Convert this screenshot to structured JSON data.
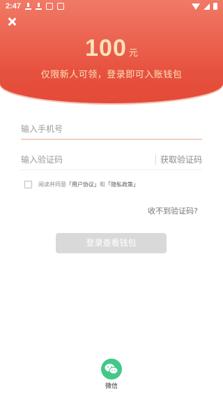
{
  "status_bar": {
    "time": "2:47"
  },
  "header": {
    "amount": "100",
    "unit": "元",
    "subtitle": "仅限新人可领，登录即可入账钱包"
  },
  "form": {
    "phone_placeholder": "输入手机号",
    "code_placeholder": "输入验证码",
    "get_code_label": "获取验证码",
    "agree_prefix": "阅读并同意",
    "user_agreement": "「用户协议」",
    "agree_and": "和",
    "privacy_policy": "「隐私政策」",
    "no_code_label": "收不到验证码?",
    "login_button": "登录查看钱包"
  },
  "social": {
    "wechat_label": "微信"
  },
  "colors": {
    "header_top": "#f07a66",
    "header_bottom": "#e44a38",
    "amount_text": "#fbe3b9",
    "wechat_green": "#43c889",
    "button_disabled": "#d9d9d9"
  }
}
